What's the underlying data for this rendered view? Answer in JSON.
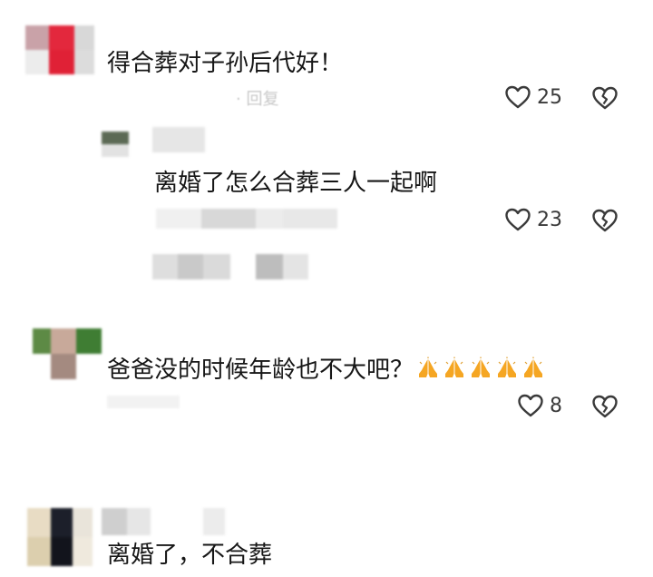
{
  "comments": [
    {
      "text": "得合葬对子孙后代好！",
      "meta_ghost": "· 回复",
      "likes": "25"
    },
    {
      "text": "离婚了怎么合葬三人一起啊",
      "meta_ghost": "· 回复",
      "likes": "23"
    },
    {
      "text": "爸爸没的时候年龄也不大吧？",
      "emoji_name": "folded-hands-emoji",
      "emoji_count": 5,
      "likes": "8"
    },
    {
      "text": "离婚了，不合葬"
    }
  ],
  "icons": {
    "like": "heart-outline-icon",
    "dislike": "broken-heart-icon"
  },
  "colors": {
    "text": "#161616",
    "icon": "#3a3a3a",
    "ghost": "#c8c8c8",
    "emoji": "#f5a623"
  }
}
